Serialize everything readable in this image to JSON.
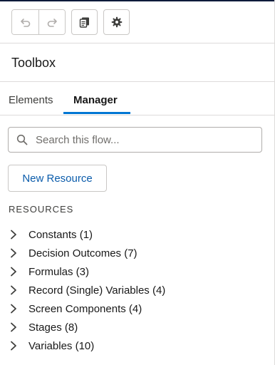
{
  "toolbar": {
    "undo": {
      "icon": "undo-icon"
    },
    "redo": {
      "icon": "redo-icon"
    },
    "copy": {
      "icon": "copy-icon"
    },
    "settings": {
      "icon": "gear-icon"
    }
  },
  "panel": {
    "title": "Toolbox"
  },
  "tabs": [
    {
      "label": "Elements",
      "active": false
    },
    {
      "label": "Manager",
      "active": true
    }
  ],
  "search": {
    "placeholder": "Search this flow...",
    "value": ""
  },
  "new_resource_label": "New Resource",
  "resources": {
    "heading": "RESOURCES",
    "items": [
      {
        "label": "Constants (1)"
      },
      {
        "label": "Decision Outcomes (7)"
      },
      {
        "label": "Formulas (3)"
      },
      {
        "label": "Record (Single) Variables (4)"
      },
      {
        "label": "Screen Components (4)"
      },
      {
        "label": "Stages (8)"
      },
      {
        "label": "Variables (10)"
      }
    ]
  },
  "colors": {
    "accent": "#0176d3",
    "link": "#0b5cab",
    "border": "#dddbda"
  }
}
